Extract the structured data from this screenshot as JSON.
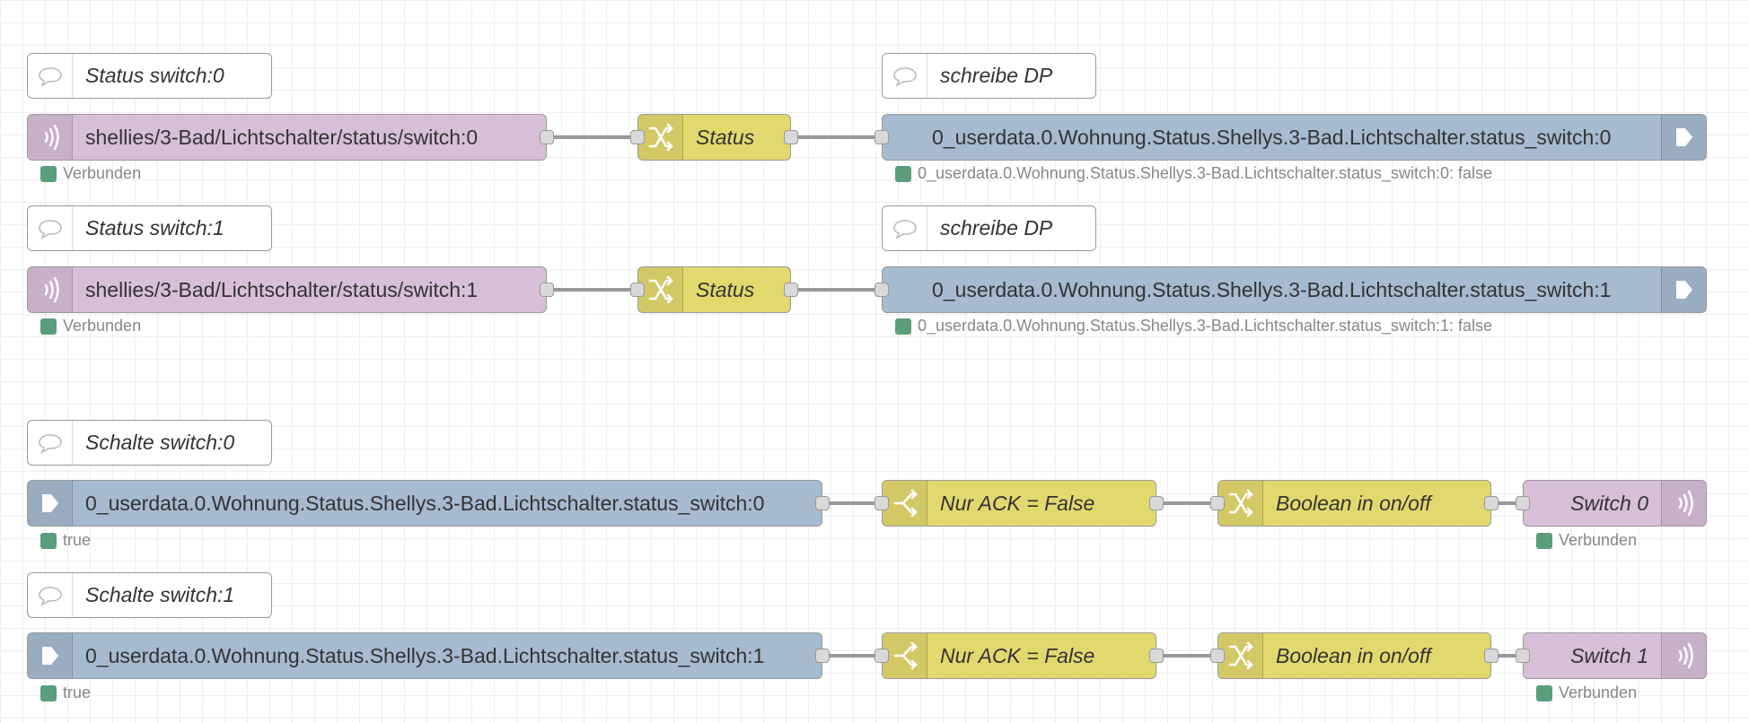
{
  "colors": {
    "mqtt_node": "#d8bfd8",
    "iobroker_node": "#a6bbcf",
    "function_node": "#e2d96e",
    "comment_node": "#ffffff",
    "status_ok": "#5a9e7d",
    "wire": "#999999"
  },
  "flow": {
    "comments": {
      "status_switch_0": "Status switch:0",
      "schreibe_dp_0": "schreibe DP",
      "status_switch_1": "Status switch:1",
      "schreibe_dp_1": "schreibe DP",
      "schalte_switch_0": "Schalte switch:0",
      "schalte_switch_1": "Schalte switch:1"
    },
    "row1": {
      "mqtt_in": "shellies/3-Bad/Lichtschalter/status/switch:0",
      "mqtt_status": "Verbunden",
      "change": "Status",
      "iob_out": "0_userdata.0.Wohnung.Status.Shellys.3-Bad.Lichtschalter.status_switch:0",
      "iob_status": "0_userdata.0.Wohnung.Status.Shellys.3-Bad.Lichtschalter.status_switch:0: false"
    },
    "row2": {
      "mqtt_in": "shellies/3-Bad/Lichtschalter/status/switch:1",
      "mqtt_status": "Verbunden",
      "change": "Status",
      "iob_out": "0_userdata.0.Wohnung.Status.Shellys.3-Bad.Lichtschalter.status_switch:1",
      "iob_status": "0_userdata.0.Wohnung.Status.Shellys.3-Bad.Lichtschalter.status_switch:1: false"
    },
    "row3": {
      "iob_in": "0_userdata.0.Wohnung.Status.Shellys.3-Bad.Lichtschalter.status_switch:0",
      "iob_status": "true",
      "switch": "Nur ACK = False",
      "change": "Boolean in on/off",
      "mqtt_out": "Switch 0",
      "mqtt_status": "Verbunden"
    },
    "row4": {
      "iob_in": "0_userdata.0.Wohnung.Status.Shellys.3-Bad.Lichtschalter.status_switch:1",
      "iob_status": "true",
      "switch": "Nur ACK = False",
      "change": "Boolean in on/off",
      "mqtt_out": "Switch 1",
      "mqtt_status": "Verbunden"
    }
  }
}
